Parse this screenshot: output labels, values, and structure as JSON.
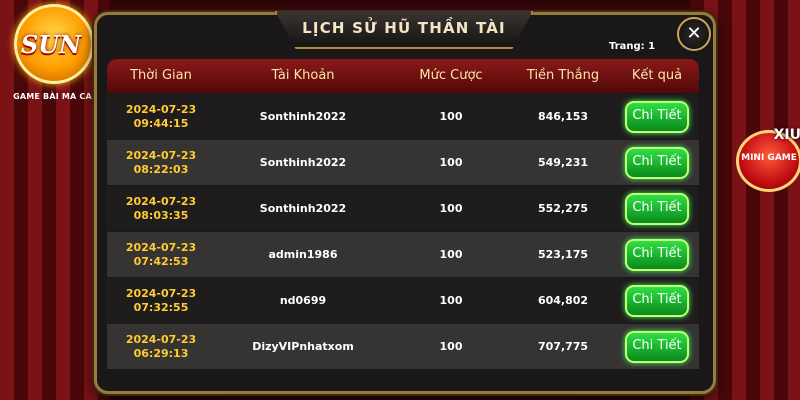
{
  "brand": {
    "logo_text": "SUN",
    "tagline": "GAME BÀI MA CAO"
  },
  "mini_game": {
    "badge": "XIU",
    "label": "MINI GAME"
  },
  "dialog": {
    "title": "LỊCH SỬ HŨ THẦN TÀI",
    "close_symbol": "✕",
    "page_label": "Trang: 1",
    "next_symbol": "›"
  },
  "table": {
    "headers": [
      "Thời Gian",
      "Tài Khoản",
      "Mức Cược",
      "Tiền Thắng",
      "Kết quả"
    ],
    "rows": [
      {
        "date": "2024-07-23",
        "time": "09:44:15",
        "account": "Sonthinh2022",
        "bet": "100",
        "win": "846,153",
        "result": "Chi Tiết"
      },
      {
        "date": "2024-07-23",
        "time": "08:22:03",
        "account": "Sonthinh2022",
        "bet": "100",
        "win": "549,231",
        "result": "Chi Tiết"
      },
      {
        "date": "2024-07-23",
        "time": "08:03:35",
        "account": "Sonthinh2022",
        "bet": "100",
        "win": "552,275",
        "result": "Chi Tiết"
      },
      {
        "date": "2024-07-23",
        "time": "07:42:53",
        "account": "admin1986",
        "bet": "100",
        "win": "523,175",
        "result": "Chi Tiết"
      },
      {
        "date": "2024-07-23",
        "time": "07:32:55",
        "account": "nd0699",
        "bet": "100",
        "win": "604,802",
        "result": "Chi Tiết"
      },
      {
        "date": "2024-07-23",
        "time": "06:29:13",
        "account": "DizyVIPnhatxom",
        "bet": "100",
        "win": "707,775",
        "result": "Chi Tiết"
      }
    ]
  },
  "colors": {
    "accent_gold": "#ffcc33",
    "button_green": "#2fdf43",
    "header_red": "#8a1a18"
  }
}
